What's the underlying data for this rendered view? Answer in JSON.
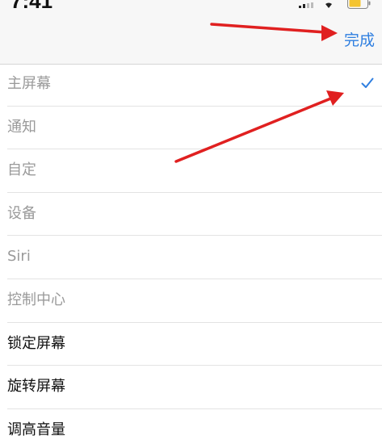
{
  "status_bar": {
    "time": "7:41"
  },
  "nav": {
    "done_label": "完成"
  },
  "menu": {
    "items": [
      {
        "label": "主屏幕",
        "selected": true,
        "enabled": false
      },
      {
        "label": "通知",
        "selected": false,
        "enabled": false
      },
      {
        "label": "自定",
        "selected": false,
        "enabled": false
      },
      {
        "label": "设备",
        "selected": false,
        "enabled": false
      },
      {
        "label": "Siri",
        "selected": false,
        "enabled": false
      },
      {
        "label": "控制中心",
        "selected": false,
        "enabled": false
      },
      {
        "label": "锁定屏幕",
        "selected": false,
        "enabled": true
      },
      {
        "label": "旋转屏幕",
        "selected": false,
        "enabled": true
      },
      {
        "label": "调高音量",
        "selected": false,
        "enabled": true
      }
    ]
  },
  "icons": {
    "checkmark": "check-icon",
    "annotations": "red-arrow-icon"
  },
  "colors": {
    "accent": "#2f7fe0",
    "annotation": "#e02020",
    "disabled_text": "#9a9a9a",
    "enabled_text": "#111111"
  }
}
